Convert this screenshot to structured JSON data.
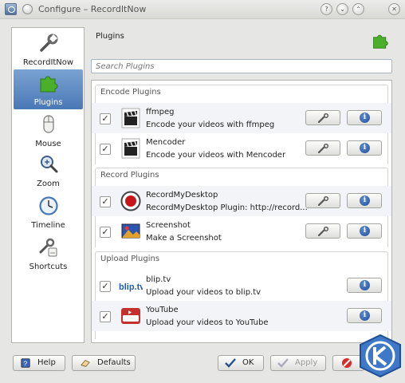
{
  "window": {
    "title": "Configure – RecordItNow",
    "buttons": [
      "?",
      "⌄",
      "⌃",
      "✕"
    ]
  },
  "sidebar": {
    "items": [
      {
        "label": "RecordItNow",
        "icon": "wrench-icon",
        "active": false
      },
      {
        "label": "Plugins",
        "icon": "puzzle-icon",
        "active": true
      },
      {
        "label": "Mouse",
        "icon": "mouse-icon",
        "active": false
      },
      {
        "label": "Zoom",
        "icon": "magnifier-icon",
        "active": false
      },
      {
        "label": "Timeline",
        "icon": "clock-icon",
        "active": false
      },
      {
        "label": "Shortcuts",
        "icon": "shortcuts-icon",
        "active": false
      }
    ]
  },
  "page": {
    "title": "Plugins",
    "search_placeholder": "Search Plugins"
  },
  "groups": [
    {
      "title": "Encode Plugins",
      "plugins": [
        {
          "name": "ffmpeg",
          "description": "Encode your videos with ffmpeg",
          "checked": "✓",
          "icon": "clapperboard-icon",
          "configurable": true
        },
        {
          "name": "Mencoder",
          "description": "Encode your videos with Mencoder",
          "checked": "✓",
          "icon": "clapperboard-icon",
          "configurable": true
        }
      ]
    },
    {
      "title": "Record Plugins",
      "plugins": [
        {
          "name": "RecordMyDesktop",
          "description": "RecordMyDesktop Plugin: http://record...",
          "checked": "✓",
          "icon": "record-icon",
          "configurable": true
        },
        {
          "name": "Screenshot",
          "description": "Make a Screenshot",
          "checked": "✓",
          "icon": "screenshot-icon",
          "configurable": true
        }
      ]
    },
    {
      "title": "Upload Plugins",
      "plugins": [
        {
          "name": "blip.tv",
          "description": "Upload your videos to blip.tv",
          "checked": "✓",
          "icon": "bliptv-logo",
          "configurable": false
        },
        {
          "name": "YouTube",
          "description": "Upload your videos to YouTube",
          "checked": "✓",
          "icon": "youtube-logo",
          "configurable": false
        }
      ]
    }
  ],
  "info_glyph": "i",
  "buttons": {
    "help": "Help",
    "defaults": "Defaults",
    "ok": "OK",
    "apply": "Apply"
  },
  "colors": {
    "selection": "#4a78b6",
    "puzzle": "#4caf2a",
    "info": "#1e4b96"
  }
}
